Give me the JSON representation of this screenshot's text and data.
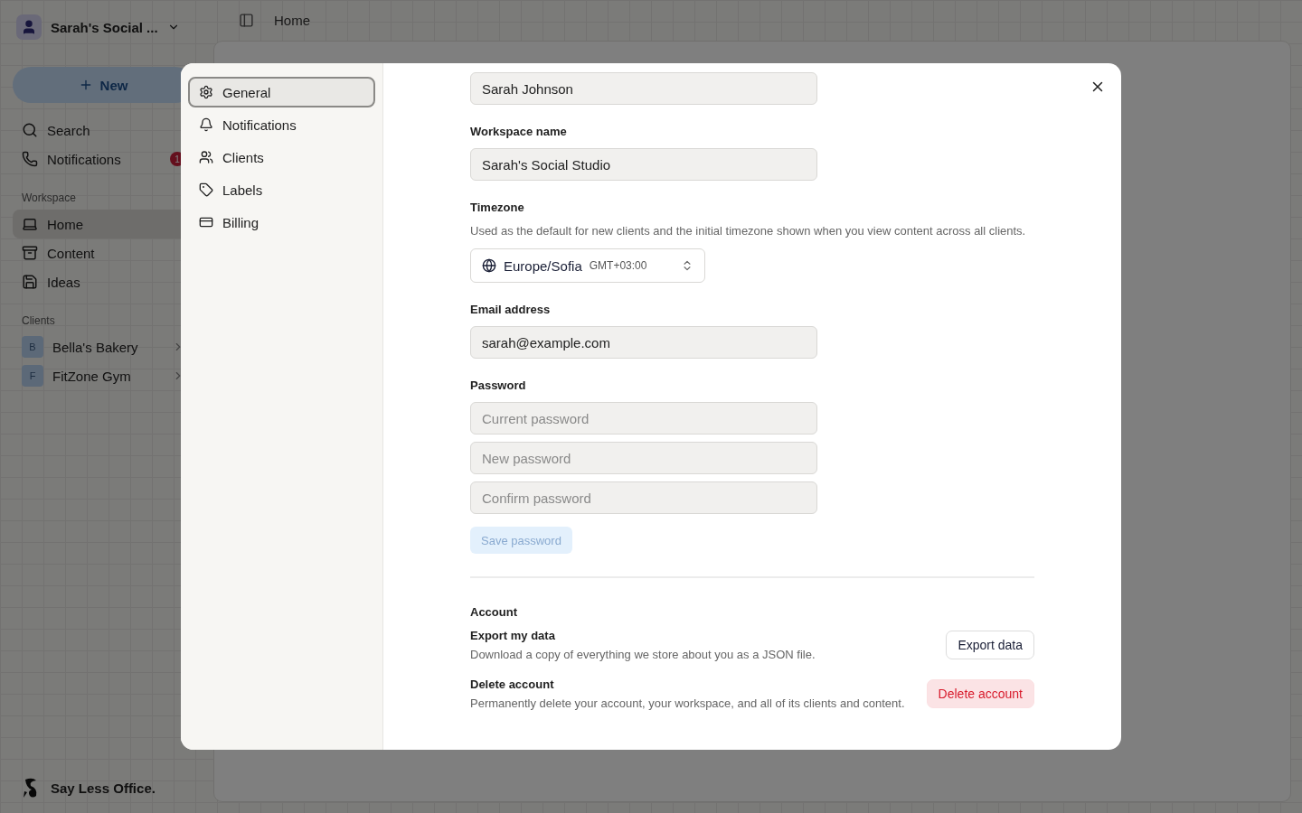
{
  "sidebar": {
    "workspace_name": "Sarah's Social ...",
    "new_button": "New",
    "nav": [
      {
        "label": "Search"
      },
      {
        "label": "Notifications",
        "badge": "1"
      }
    ],
    "workspace_section": {
      "title": "Workspace",
      "items": [
        {
          "label": "Home",
          "selected": true
        },
        {
          "label": "Content",
          "selected": false
        },
        {
          "label": "Ideas",
          "selected": false
        }
      ]
    },
    "clients_section": {
      "title": "Clients",
      "items": [
        {
          "initial": "B",
          "label": "Bella's Bakery"
        },
        {
          "initial": "F",
          "label": "FitZone Gym"
        }
      ]
    },
    "brand": "Say Less Office."
  },
  "topbar": {
    "breadcrumb": "Home"
  },
  "settings": {
    "nav": [
      {
        "label": "General",
        "selected": true
      },
      {
        "label": "Notifications",
        "selected": false
      },
      {
        "label": "Clients",
        "selected": false
      },
      {
        "label": "Labels",
        "selected": false
      },
      {
        "label": "Billing",
        "selected": false
      }
    ],
    "name": {
      "value": "Sarah Johnson"
    },
    "workspace_name": {
      "label": "Workspace name",
      "value": "Sarah's Social Studio"
    },
    "timezone": {
      "label": "Timezone",
      "description": "Used as the default for new clients and the initial timezone shown when you view content across all clients.",
      "value": "Europe/Sofia",
      "offset": "GMT+03:00"
    },
    "email": {
      "label": "Email address",
      "value": "sarah@example.com"
    },
    "password": {
      "label": "Password",
      "placeholders": [
        "Current password",
        "New password",
        "Confirm password"
      ],
      "save_button": {
        "label": "Save password",
        "disabled": true
      }
    },
    "account": {
      "title": "Account",
      "rows": [
        {
          "title": "Export my data",
          "description": "Download a copy of everything we store about you as a JSON file.",
          "button": {
            "label": "Export data",
            "kind": "outline"
          }
        },
        {
          "title": "Delete account",
          "description": "Permanently delete your account, your workspace, and all of its clients and content.",
          "button": {
            "label": "Delete account",
            "kind": "danger"
          }
        }
      ]
    }
  }
}
